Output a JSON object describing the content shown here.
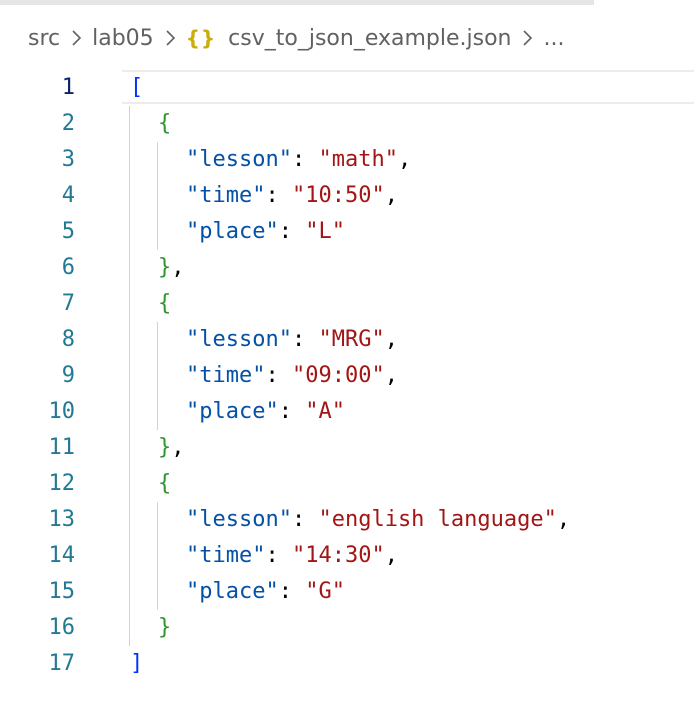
{
  "breadcrumb": {
    "folder1": "src",
    "folder2": "lab05",
    "icon": "{}",
    "file": "csv_to_json_example.json",
    "more": "..."
  },
  "editor": {
    "active_line": 1,
    "lines": [
      {
        "num": "1",
        "tokens": [
          {
            "t": "[",
            "c": "b1"
          }
        ]
      },
      {
        "num": "2",
        "tokens": [
          {
            "t": "{",
            "c": "b2"
          }
        ]
      },
      {
        "num": "3",
        "tokens": [
          {
            "t": "\"lesson\"",
            "c": "key"
          },
          {
            "t": ": ",
            "c": "punc"
          },
          {
            "t": "\"math\"",
            "c": "str"
          },
          {
            "t": ",",
            "c": "punc"
          }
        ]
      },
      {
        "num": "4",
        "tokens": [
          {
            "t": "\"time\"",
            "c": "key"
          },
          {
            "t": ": ",
            "c": "punc"
          },
          {
            "t": "\"10:50\"",
            "c": "str"
          },
          {
            "t": ",",
            "c": "punc"
          }
        ]
      },
      {
        "num": "5",
        "tokens": [
          {
            "t": "\"place\"",
            "c": "key"
          },
          {
            "t": ": ",
            "c": "punc"
          },
          {
            "t": "\"L\"",
            "c": "str"
          }
        ]
      },
      {
        "num": "6",
        "tokens": [
          {
            "t": "}",
            "c": "b2"
          },
          {
            "t": ",",
            "c": "punc"
          }
        ]
      },
      {
        "num": "7",
        "tokens": [
          {
            "t": "{",
            "c": "b2"
          }
        ]
      },
      {
        "num": "8",
        "tokens": [
          {
            "t": "\"lesson\"",
            "c": "key"
          },
          {
            "t": ": ",
            "c": "punc"
          },
          {
            "t": "\"MRG\"",
            "c": "str"
          },
          {
            "t": ",",
            "c": "punc"
          }
        ]
      },
      {
        "num": "9",
        "tokens": [
          {
            "t": "\"time\"",
            "c": "key"
          },
          {
            "t": ": ",
            "c": "punc"
          },
          {
            "t": "\"09:00\"",
            "c": "str"
          },
          {
            "t": ",",
            "c": "punc"
          }
        ]
      },
      {
        "num": "10",
        "tokens": [
          {
            "t": "\"place\"",
            "c": "key"
          },
          {
            "t": ": ",
            "c": "punc"
          },
          {
            "t": "\"A\"",
            "c": "str"
          }
        ]
      },
      {
        "num": "11",
        "tokens": [
          {
            "t": "}",
            "c": "b2"
          },
          {
            "t": ",",
            "c": "punc"
          }
        ]
      },
      {
        "num": "12",
        "tokens": [
          {
            "t": "{",
            "c": "b2"
          }
        ]
      },
      {
        "num": "13",
        "tokens": [
          {
            "t": "\"lesson\"",
            "c": "key"
          },
          {
            "t": ": ",
            "c": "punc"
          },
          {
            "t": "\"english language\"",
            "c": "str"
          },
          {
            "t": ",",
            "c": "punc"
          }
        ]
      },
      {
        "num": "14",
        "tokens": [
          {
            "t": "\"time\"",
            "c": "key"
          },
          {
            "t": ": ",
            "c": "punc"
          },
          {
            "t": "\"14:30\"",
            "c": "str"
          },
          {
            "t": ",",
            "c": "punc"
          }
        ]
      },
      {
        "num": "15",
        "tokens": [
          {
            "t": "\"place\"",
            "c": "key"
          },
          {
            "t": ": ",
            "c": "punc"
          },
          {
            "t": "\"G\"",
            "c": "str"
          }
        ]
      },
      {
        "num": "16",
        "tokens": [
          {
            "t": "}",
            "c": "b2"
          }
        ]
      },
      {
        "num": "17",
        "tokens": [
          {
            "t": "]",
            "c": "b1"
          }
        ]
      }
    ]
  },
  "colors": {
    "line_number": "#237893",
    "bracket_outer": "#0431fa",
    "bracket_inner": "#319331",
    "json_key": "#0451a5",
    "json_string": "#a31515",
    "json_icon": "#c9ad0a"
  }
}
